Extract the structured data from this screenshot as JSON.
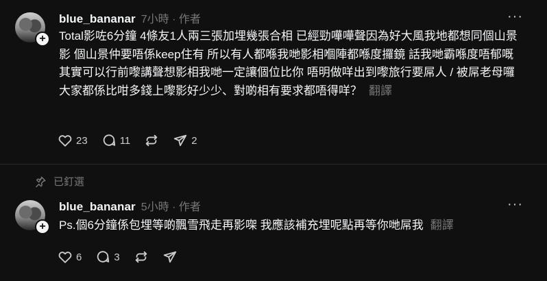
{
  "post1": {
    "username": "blue_bananar",
    "time": "7小時",
    "role": "作者",
    "text": "Total影咗6分鐘 4條友1人兩三張加埋幾張合相 已經勁嘩嘩聲因為好大風我地都想同個山景影 個山景仲要唔係keep住有 所以有人都喺我哋影相嗰陣都喺度攞鏡 話我哋霸喺度唔郁嘅其實可以行前嚟講聲想影相我哋一定讓個位比你 唔明做咩出到嚟旅行要屌人 / 被屌老母囉 大家都係比咁多錢上嚟影好少少、對啲相有要求都唔得咩？",
    "translate": "翻譯",
    "likes": "23",
    "comments": "11",
    "shares": "2"
  },
  "pinned_label": "已釘選",
  "post2": {
    "username": "blue_bananar",
    "time": "5小時",
    "role": "作者",
    "text": "Ps.個6分鐘係包埋等啲飄雪飛走再影㗎 我應該補充埋呢點再等你哋屌我",
    "translate": "翻譯",
    "likes": "6",
    "comments": "3"
  },
  "icons": {
    "like": "heart-icon",
    "comment": "comment-icon",
    "repost": "repost-icon",
    "share": "send-icon",
    "more": "more-icon",
    "pin": "pin-icon",
    "follow": "plus-icon"
  },
  "colors": {
    "background": "#101010",
    "text": "#f3f5f7",
    "muted": "#777777"
  }
}
